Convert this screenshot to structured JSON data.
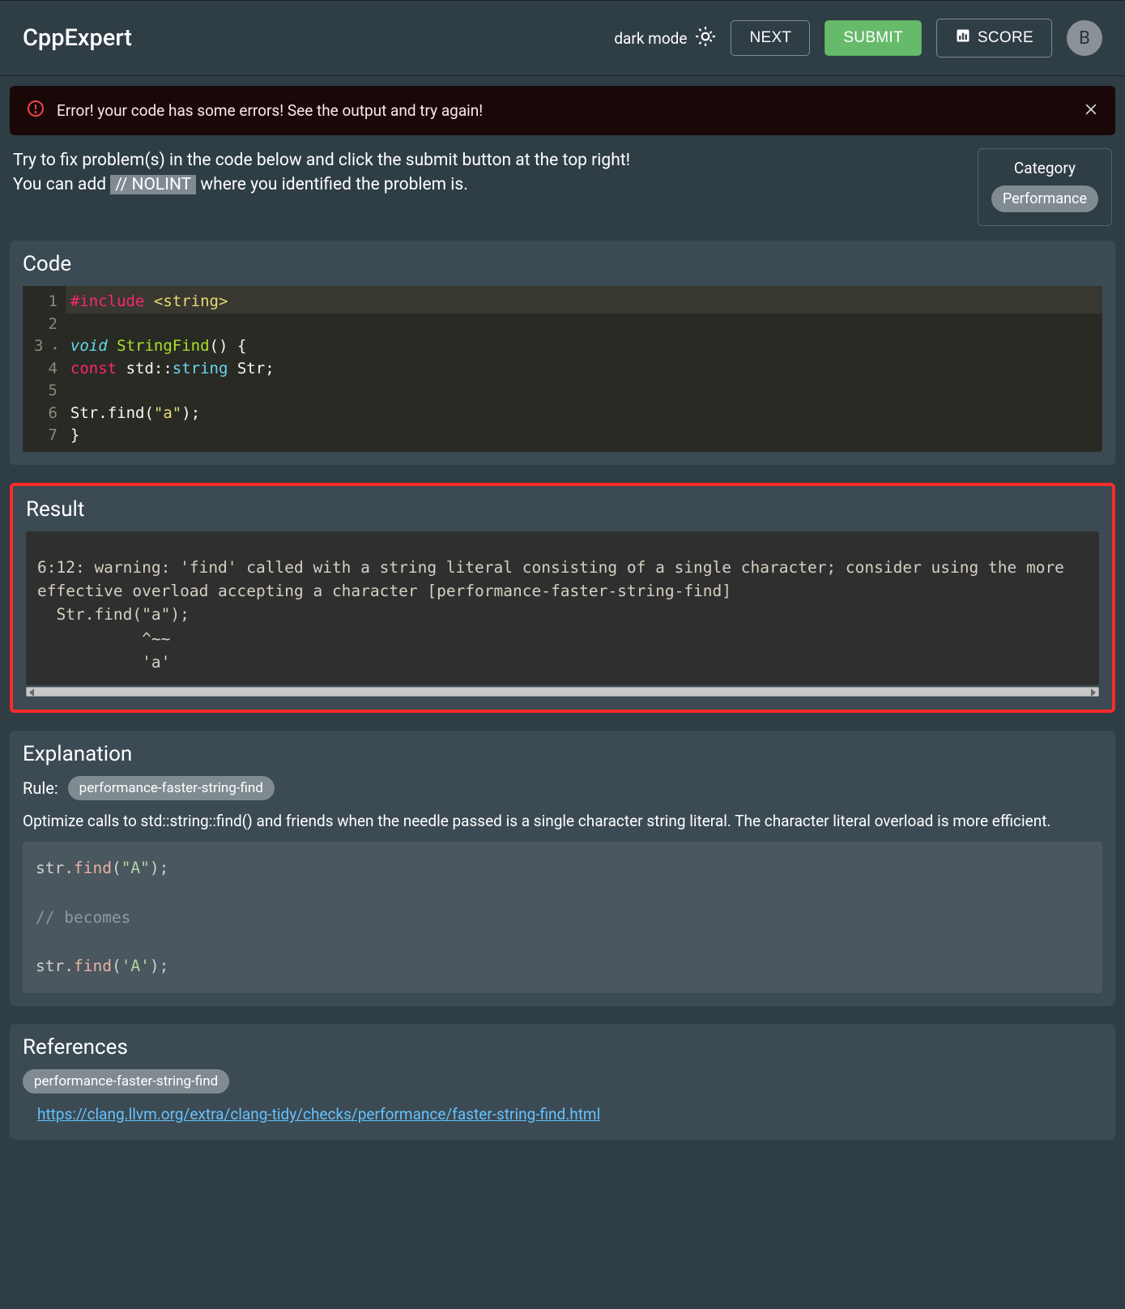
{
  "header": {
    "title": "CppExpert",
    "dark_mode_label": "dark mode",
    "next_label": "NEXT",
    "submit_label": "SUBMIT",
    "score_label": "SCORE",
    "avatar_initial": "B"
  },
  "alert": {
    "text": "Error! your code has some errors! See the output and try again!"
  },
  "intro": {
    "line1": "Try to fix problem(s) in the code below and click the submit button at the top right!",
    "line2_pre": "You can add ",
    "nolint": "// NOLINT",
    "line2_post": " where you identified the problem is."
  },
  "category": {
    "label": "Category",
    "value": "Performance"
  },
  "code_panel": {
    "title": "Code",
    "lines": [
      {
        "n": "1",
        "raw": "#include <string>",
        "tokens": [
          [
            "keyword2",
            "#include "
          ],
          [
            "str",
            "<string>"
          ]
        ]
      },
      {
        "n": "2",
        "raw": "",
        "tokens": []
      },
      {
        "n": "3",
        "raw": "void StringFind() {",
        "fold": true,
        "tokens": [
          [
            "void",
            "void "
          ],
          [
            "func",
            "StringFind"
          ],
          [
            "punc",
            "() {"
          ]
        ]
      },
      {
        "n": "4",
        "raw": "  const std::string Str;",
        "tokens": [
          [
            "punc",
            "  "
          ],
          [
            "keyword2",
            "const "
          ],
          [
            "ident",
            "std"
          ],
          [
            "punc",
            "::"
          ],
          [
            "type",
            "string "
          ],
          [
            "ident",
            "Str"
          ],
          [
            "punc",
            ";"
          ]
        ]
      },
      {
        "n": "5",
        "raw": "",
        "tokens": []
      },
      {
        "n": "6",
        "raw": "  Str.find(\"a\");",
        "tokens": [
          [
            "punc",
            "  "
          ],
          [
            "ident",
            "Str"
          ],
          [
            "punc",
            "."
          ],
          [
            "ident",
            "find"
          ],
          [
            "punc",
            "("
          ],
          [
            "str",
            "\"a\""
          ],
          [
            "punc",
            ");"
          ]
        ]
      },
      {
        "n": "7",
        "raw": "}",
        "tokens": [
          [
            "punc",
            "}"
          ]
        ]
      }
    ]
  },
  "result_panel": {
    "title": "Result",
    "output": "6:12: warning: 'find' called with a string literal consisting of a single character; consider using the more \neffective overload accepting a character [performance-faster-string-find]\n  Str.find(\"a\");\n           ^~~\n           'a'"
  },
  "explanation_panel": {
    "title": "Explanation",
    "rule_label": "Rule:",
    "rule_chip": "performance-faster-string-find",
    "description": "Optimize calls to std::string::find() and friends when the needle passed is a single character string literal. The character literal overload is more efficient.",
    "example": {
      "l1_ident": "str.",
      "l1_func": "find",
      "l1_open": "(",
      "l1_str": "\"A\"",
      "l1_close": ");",
      "comment": "// becomes",
      "l3_ident": "str.",
      "l3_func": "find",
      "l3_open": "(",
      "l3_char": "'A'",
      "l3_close": ");"
    }
  },
  "references_panel": {
    "title": "References",
    "chip": "performance-faster-string-find",
    "link_text": "https://clang.llvm.org/extra/clang-tidy/checks/performance/faster-string-find.html"
  }
}
